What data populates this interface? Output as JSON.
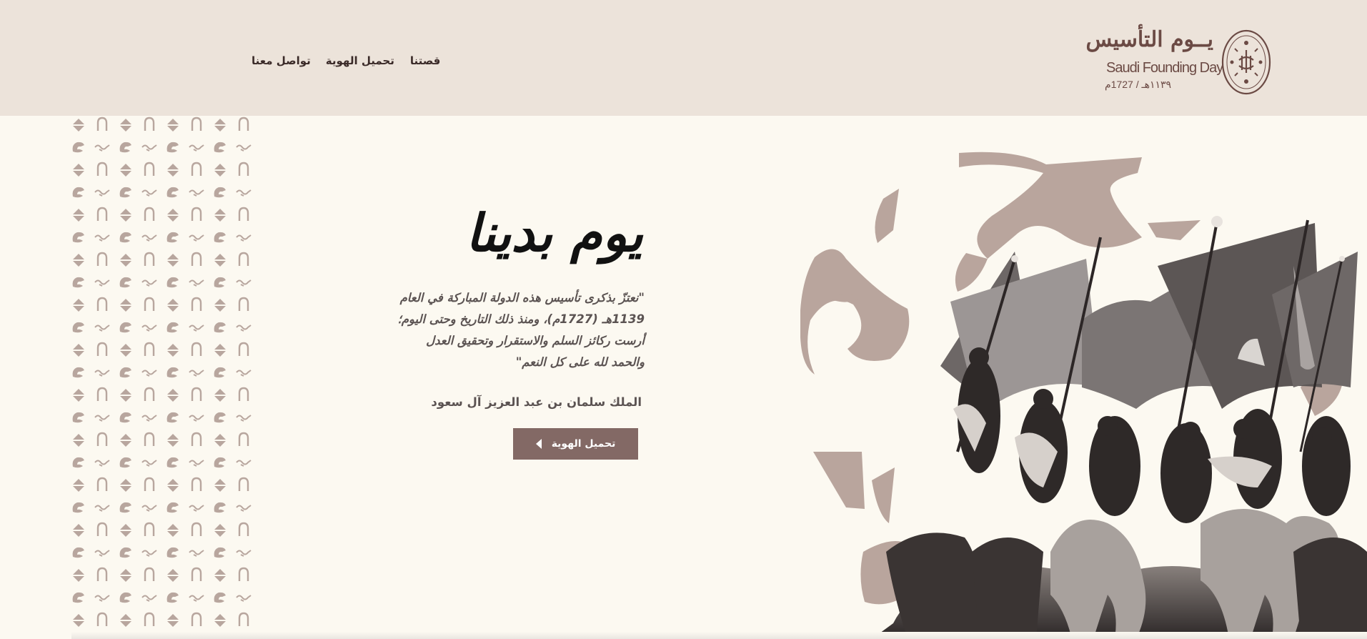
{
  "header": {
    "nav": [
      {
        "label": "تواصل معنا"
      },
      {
        "label": "تحميل الهوية"
      },
      {
        "label": "قصتنا"
      }
    ],
    "logo": {
      "arabic": "يــوم التأسيس",
      "english": "Saudi Founding Day",
      "date": "١١٣٩هـ / 1727م",
      "emblem": "founding-day-seal-icon"
    }
  },
  "hero": {
    "title": "يوم بدينا",
    "quote_lines": [
      "\"نعتزّ بذكرى تأسيس هذه الدولة المباركة في العام",
      "1139هـ (1727م)، ومنذ ذلك التاريخ وحتى اليوم؛",
      "أرست ركائز السلم والاستقرار وتحقيق العدل",
      "والحمد لله على كل النعم\""
    ],
    "author": "الملك سلمان بن عبد العزيز آل سعود",
    "cta_label": "تحميل الهوية",
    "cta_icon": "chevron-left-icon"
  },
  "colors": {
    "header_bg": "#ece3da",
    "page_bg": "#fcf9f1",
    "accent": "#836965",
    "pattern": "#b8a69e"
  }
}
